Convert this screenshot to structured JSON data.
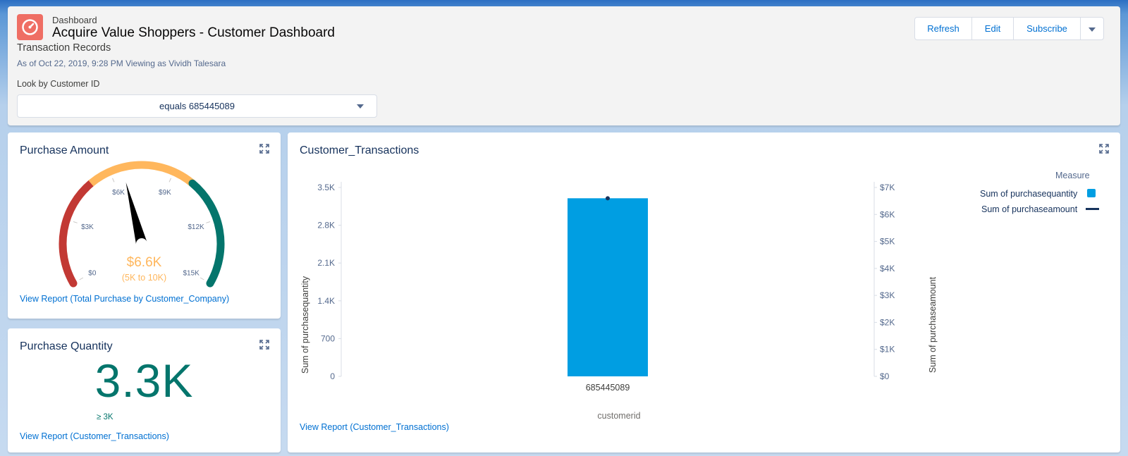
{
  "header": {
    "kicker": "Dashboard",
    "title": "Acquire Value Shoppers - Customer Dashboard",
    "subtitle": "Transaction Records",
    "as_of": "As of Oct 22, 2019, 9:28 PM Viewing as Vividh Talesara",
    "filter_label": "Look by Customer ID",
    "filter_value": "equals 685445089",
    "buttons": {
      "refresh": "Refresh",
      "edit": "Edit",
      "subscribe": "Subscribe"
    },
    "icon": "gauge-icon",
    "icon_color": "#ef6e64"
  },
  "purchase_amount": {
    "title": "Purchase Amount",
    "value": "$6.6K",
    "band": "(5K to 10K)",
    "link": "View Report (Total Purchase by Customer_Company)",
    "gauge_labels": [
      "$0",
      "$3K",
      "$6K",
      "$9K",
      "$12K",
      "$15K"
    ],
    "gauge_min": 0,
    "gauge_max": 15000,
    "needle_value": 6600,
    "bands": [
      {
        "from": 0,
        "to": 5000,
        "color": "#c23934"
      },
      {
        "from": 5000,
        "to": 10000,
        "color": "#ffb75d"
      },
      {
        "from": 10000,
        "to": 15000,
        "color": "#04756c"
      }
    ]
  },
  "purchase_quantity": {
    "title": "Purchase Quantity",
    "value": "3.3K",
    "range": "≥ 3K",
    "link": "View Report (Customer_Transactions)"
  },
  "transactions": {
    "title": "Customer_Transactions",
    "link": "View Report (Customer_Transactions)",
    "legend_title": "Measure",
    "legend_series": [
      "Sum of purchasequantity",
      "Sum of purchaseamount"
    ]
  },
  "chart_data": {
    "type": "bar",
    "categories": [
      "685445089"
    ],
    "series": [
      {
        "name": "Sum of purchasequantity",
        "values": [
          3300
        ],
        "axis": "left",
        "kind": "bar",
        "color": "#009ee2"
      },
      {
        "name": "Sum of purchaseamount",
        "values": [
          6600
        ],
        "axis": "right",
        "kind": "line",
        "color": "#16325c"
      }
    ],
    "xlabel": "customerid",
    "ylabel": "Sum of purchasequantity",
    "y2label": "Sum of purchaseamount",
    "ylim": [
      0,
      3500
    ],
    "y2lim": [
      0,
      7000
    ],
    "yticks": [
      0,
      700,
      1400,
      2100,
      2800,
      3500
    ],
    "ytick_labels": [
      "0",
      "700",
      "1.4K",
      "2.1K",
      "2.8K",
      "3.5K"
    ],
    "y2ticks": [
      0,
      1000,
      2000,
      3000,
      4000,
      5000,
      6000,
      7000
    ],
    "y2tick_labels": [
      "$0",
      "$1K",
      "$2K",
      "$3K",
      "$4K",
      "$5K",
      "$6K",
      "$7K"
    ],
    "legend": "top-right"
  }
}
